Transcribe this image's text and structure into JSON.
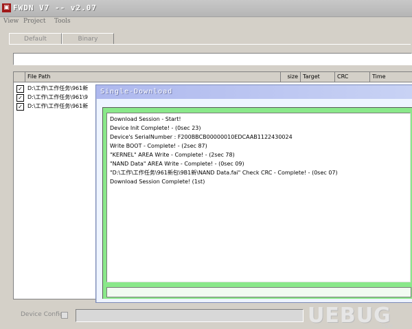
{
  "window": {
    "title": "FWDN V7 -- v2.07",
    "icon": "app-chip-icon"
  },
  "menu": [
    "View",
    "Project",
    "Tools"
  ],
  "tabs": [
    {
      "label": "Default",
      "active": true
    },
    {
      "label": "Binary",
      "active": false
    }
  ],
  "path_input": {
    "value": ""
  },
  "file_list": {
    "columns": [
      "File Path",
      "size",
      "Target",
      "CRC",
      "Time"
    ],
    "rows": [
      {
        "checked": true,
        "path": "D:\\工作\\工作任务\\961新"
      },
      {
        "checked": true,
        "path": "D:\\工作\\工作任务\\961\\9"
      },
      {
        "checked": true,
        "path": "D:\\工作\\工作任务\\961新"
      }
    ]
  },
  "dialog": {
    "title": "Single-Download",
    "log": [
      "Download Session - Start!",
      "Device Init Complete! - (0sec 23)",
      "Device's SerialNumber : F200BBCB00000010EDCAAB1122430024",
      "Write BOOT - Complete! - (2sec 87)",
      "\"KERNEL\" AREA Write - Complete! - (2sec 78)",
      "\"NAND Data\" AREA Write - Complete! - (0sec 09)",
      "\"D:\\工作\\工作任务\\961新包\\9B1新\\NAND Data.fai\" Check CRC - Complete! - (0sec 07)",
      "Download Session Complete! (1st)"
    ],
    "status": "",
    "accent_color": "#8ae88a"
  },
  "bottom": {
    "device_config_label": "Device Config",
    "device_config_checked": false,
    "field_value": ""
  },
  "watermark": {
    "text": "UEBUG",
    "sub": "下载站"
  }
}
